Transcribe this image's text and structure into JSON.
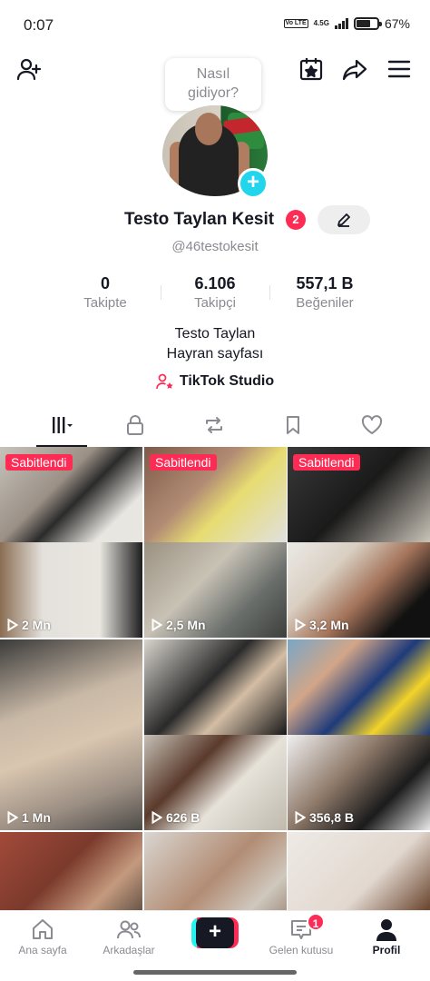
{
  "status_bar": {
    "time": "0:07",
    "volte": "Vo LTE",
    "network": "4.5G",
    "battery_percent": "67",
    "battery_suffix": "%",
    "battery_level": 0.67
  },
  "top_bar": {
    "icons": [
      "add-friend-icon",
      "calendar-star-icon",
      "share-icon",
      "menu-icon"
    ]
  },
  "bubble": {
    "line1": "Nasıl",
    "line2": "gidiyor?"
  },
  "profile": {
    "name": "Testo Taylan Kesit",
    "name_badge": "2",
    "handle": "@46testokesit",
    "bio_line1": "Testo Taylan",
    "bio_line2": "Hayran sayfası",
    "studio_label": "TikTok Studio"
  },
  "stats": [
    {
      "value": "0",
      "label": "Takipte"
    },
    {
      "value": "6.106",
      "label": "Takipçi"
    },
    {
      "value": "557,1 B",
      "label": "Beğeniler"
    }
  ],
  "tabs": [
    "videos-grid-icon",
    "lock-icon",
    "repost-icon",
    "bookmark-icon",
    "heart-icon"
  ],
  "grid": {
    "pinned_label": "Sabitlendi",
    "cells": [
      {
        "pinned": true,
        "views": "2 Mn"
      },
      {
        "pinned": true,
        "views": "2,5 Mn"
      },
      {
        "pinned": true,
        "views": "3,2 Mn"
      },
      {
        "pinned": false,
        "views": "1 Mn"
      },
      {
        "pinned": false,
        "views": "626 B"
      },
      {
        "pinned": false,
        "views": "356,8 B"
      }
    ]
  },
  "bottom_nav": {
    "home": "Ana sayfa",
    "friends": "Arkadaşlar",
    "create": "+",
    "inbox": "Gelen kutusu",
    "inbox_badge": "1",
    "profile": "Profil"
  },
  "colors": {
    "accent": "#fe2c55",
    "cyan": "#20d5ec",
    "text": "#161823",
    "muted": "#8a8b91"
  }
}
